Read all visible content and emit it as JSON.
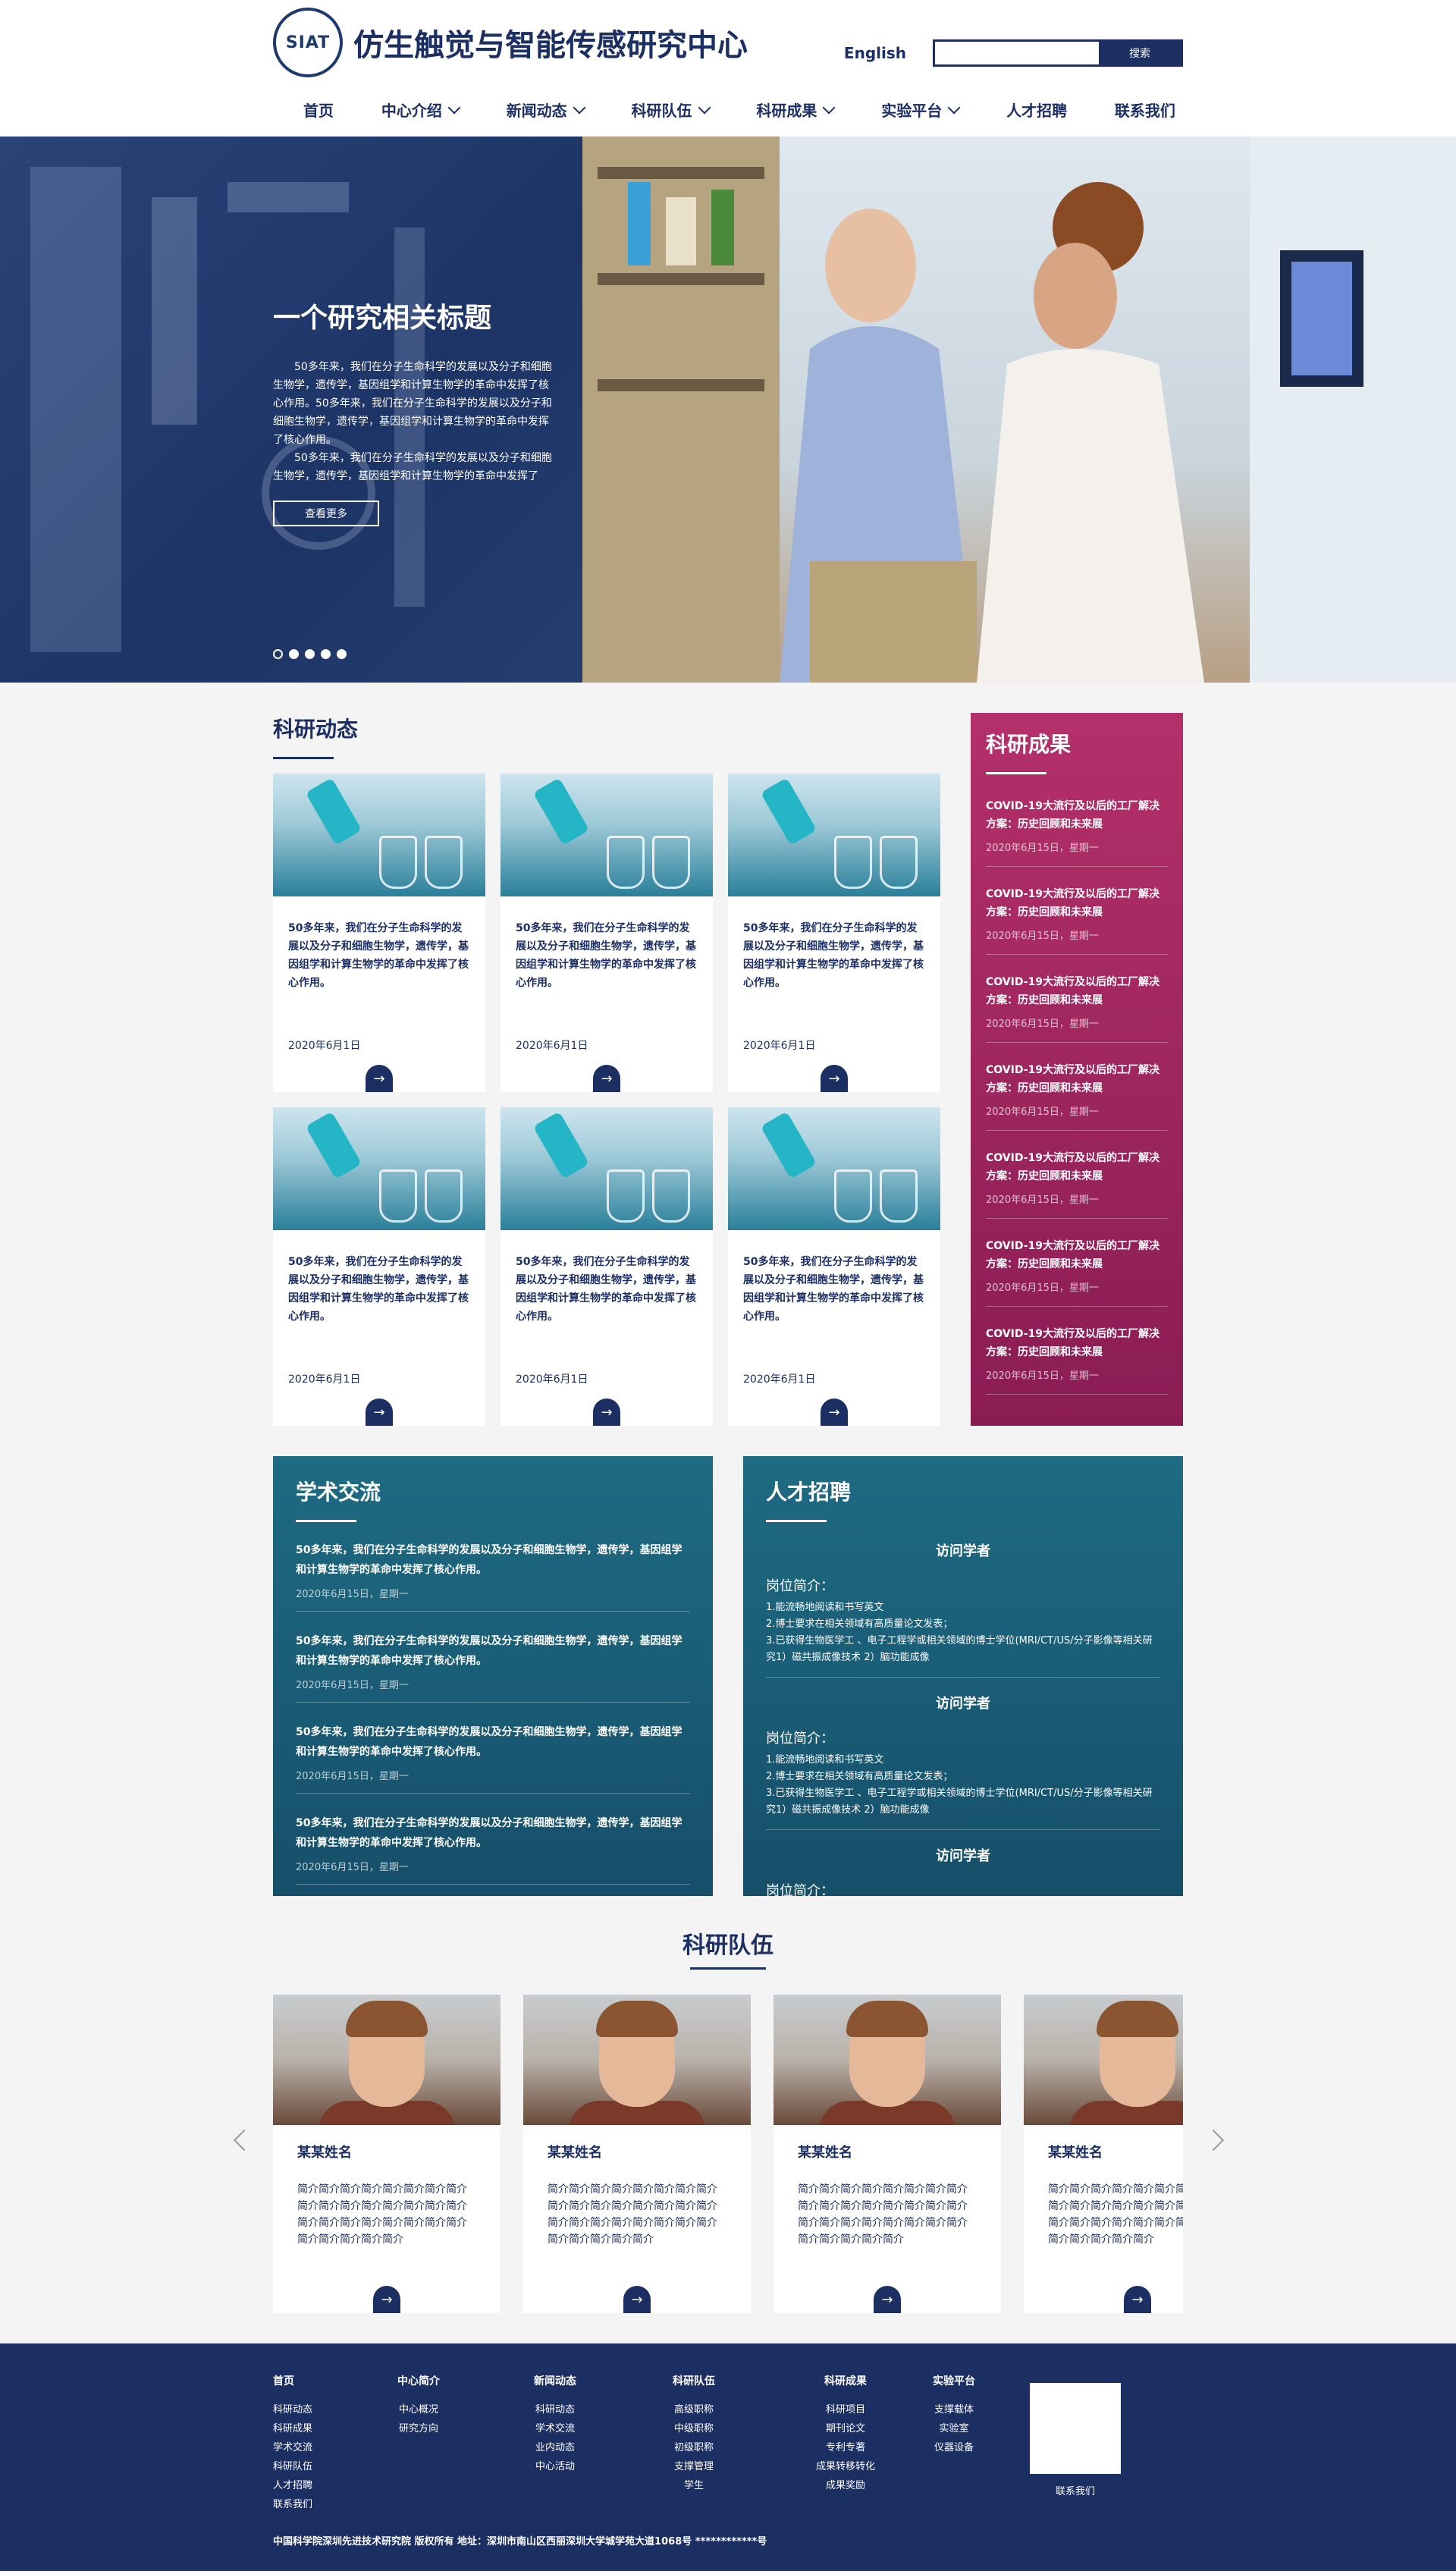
{
  "header": {
    "logo_text": "SIAT",
    "title": "仿生触觉与智能传感研究中心",
    "lang": "English",
    "search_placeholder": "",
    "search_button": "搜索"
  },
  "nav": [
    {
      "label": "首页",
      "has_menu": false
    },
    {
      "label": "中心介绍",
      "has_menu": true
    },
    {
      "label": "新闻动态",
      "has_menu": true
    },
    {
      "label": "科研队伍",
      "has_menu": true
    },
    {
      "label": "科研成果",
      "has_menu": true
    },
    {
      "label": "实验平台",
      "has_menu": true
    },
    {
      "label": "人才招聘",
      "has_menu": false
    },
    {
      "label": "联系我们",
      "has_menu": false
    }
  ],
  "hero": {
    "title": "一个研究相关标题",
    "paragraphs": [
      "50多年来，我们在分子生命科学的发展以及分子和细胞生物学，遗传学，基因组学和计算生物学的革命中发挥了核心作用。50多年来，我们在分子生命科学的发展以及分子和细胞生物学，遗传学，基因组学和计算生物学的革命中发挥了核心作用。",
      "50多年来，我们在分子生命科学的发展以及分子和细胞生物学，遗传学，基因组学和计算生物学的革命中发挥了"
    ],
    "button": "查看更多",
    "dots": 5
  },
  "news": {
    "title": "科研动态",
    "items": [
      {
        "text": "50多年来，我们在分子生命科学的发展以及分子和细胞生物学，遗传学，基因组学和计算生物学的革命中发挥了核心作用。",
        "date": "2020年6月1日"
      },
      {
        "text": "50多年来，我们在分子生命科学的发展以及分子和细胞生物学，遗传学，基因组学和计算生物学的革命中发挥了核心作用。",
        "date": "2020年6月1日"
      },
      {
        "text": "50多年来，我们在分子生命科学的发展以及分子和细胞生物学，遗传学，基因组学和计算生物学的革命中发挥了核心作用。",
        "date": "2020年6月1日"
      },
      {
        "text": "50多年来，我们在分子生命科学的发展以及分子和细胞生物学，遗传学，基因组学和计算生物学的革命中发挥了核心作用。",
        "date": "2020年6月1日"
      },
      {
        "text": "50多年来，我们在分子生命科学的发展以及分子和细胞生物学，遗传学，基因组学和计算生物学的革命中发挥了核心作用。",
        "date": "2020年6月1日"
      },
      {
        "text": "50多年来，我们在分子生命科学的发展以及分子和细胞生物学，遗传学，基因组学和计算生物学的革命中发挥了核心作用。",
        "date": "2020年6月1日"
      }
    ]
  },
  "results": {
    "title": "科研成果",
    "items": [
      {
        "title": "COVID-19大流行及以后的工厂解决方案：历史回顾和未来展",
        "date": "2020年6月15日，星期一"
      },
      {
        "title": "COVID-19大流行及以后的工厂解决方案：历史回顾和未来展",
        "date": "2020年6月15日，星期一"
      },
      {
        "title": "COVID-19大流行及以后的工厂解决方案：历史回顾和未来展",
        "date": "2020年6月15日，星期一"
      },
      {
        "title": "COVID-19大流行及以后的工厂解决方案：历史回顾和未来展",
        "date": "2020年6月15日，星期一"
      },
      {
        "title": "COVID-19大流行及以后的工厂解决方案：历史回顾和未来展",
        "date": "2020年6月15日，星期一"
      },
      {
        "title": "COVID-19大流行及以后的工厂解决方案：历史回顾和未来展",
        "date": "2020年6月15日，星期一"
      },
      {
        "title": "COVID-19大流行及以后的工厂解决方案：历史回顾和未来展",
        "date": "2020年6月15日，星期一"
      }
    ]
  },
  "academic": {
    "title": "学术交流",
    "items": [
      {
        "title": "50多年来，我们在分子生命科学的发展以及分子和细胞生物学，遗传学，基因组学和计算生物学的革命中发挥了核心作用。",
        "date": "2020年6月15日，星期一"
      },
      {
        "title": "50多年来，我们在分子生命科学的发展以及分子和细胞生物学，遗传学，基因组学和计算生物学的革命中发挥了核心作用。",
        "date": "2020年6月15日，星期一"
      },
      {
        "title": "50多年来，我们在分子生命科学的发展以及分子和细胞生物学，遗传学，基因组学和计算生物学的革命中发挥了核心作用。",
        "date": "2020年6月15日，星期一"
      },
      {
        "title": "50多年来，我们在分子生命科学的发展以及分子和细胞生物学，遗传学，基因组学和计算生物学的革命中发挥了核心作用。",
        "date": "2020年6月15日，星期一"
      }
    ]
  },
  "talent": {
    "title": "人才招聘",
    "jobs": [
      {
        "heading": "访问学者",
        "label": "岗位简介：",
        "reqs": [
          "1.能流畅地阅读和书写英文",
          "2.博士要求在相关领域有高质量论文发表；",
          "3.已获得生物医学工 、电子工程学或相关领域的博士学位(MRI/CT/US/分子影像等相关研究1）磁共振成像技术 2）脑功能成像"
        ]
      },
      {
        "heading": "访问学者",
        "label": "岗位简介：",
        "reqs": [
          "1.能流畅地阅读和书写英文",
          "2.博士要求在相关领域有高质量论文发表；",
          "3.已获得生物医学工 、电子工程学或相关领域的博士学位(MRI/CT/US/分子影像等相关研究1）磁共振成像技术 2）脑功能成像"
        ]
      },
      {
        "heading": "访问学者",
        "label": "岗位简介：",
        "reqs": []
      }
    ]
  },
  "team": {
    "title": "科研队伍",
    "members": [
      {
        "name": "某某姓名",
        "intro": "简介简介简介简介简介简介简介简介简介简介简介简介简介简介简介简介简介简介简介简介简介简介简介简介简介简介简介简介简介"
      },
      {
        "name": "某某姓名",
        "intro": "简介简介简介简介简介简介简介简介简介简介简介简介简介简介简介简介简介简介简介简介简介简介简介简介简介简介简介简介简介"
      },
      {
        "name": "某某姓名",
        "intro": "简介简介简介简介简介简介简介简介简介简介简介简介简介简介简介简介简介简介简介简介简介简介简介简介简介简介简介简介简介"
      },
      {
        "name": "某某姓名",
        "intro": "简介简介简介简介简介简介简介简介简介简介简介简介简介简介简介简介简介简介简介简介简介简介简介简介简介简介简介简介简介"
      }
    ]
  },
  "footer": {
    "columns": [
      {
        "heading": "首页",
        "links": [
          "科研动态",
          "科研成果",
          "学术交流",
          "科研队伍",
          "人才招聘",
          "联系我们"
        ]
      },
      {
        "heading": "中心简介",
        "links": [
          "中心概况",
          "研究方向"
        ]
      },
      {
        "heading": "新闻动态",
        "links": [
          "科研动态",
          "学术交流",
          "业内动态",
          "中心活动"
        ]
      },
      {
        "heading": "科研队伍",
        "links": [
          "高级职称",
          "中级职称",
          "初级职称",
          "支撑管理",
          "学生"
        ]
      },
      {
        "heading": "科研成果",
        "links": [
          "科研项目",
          "期刊论文",
          "专利专著",
          "成果转移转化",
          "成果奖励"
        ]
      },
      {
        "heading": "实验平台",
        "links": [
          "支撑载体",
          "实验室",
          "仪器设备"
        ]
      }
    ],
    "qr_label": "联系我们",
    "copyright": "中国科学院深圳先进技术研究院    版权所有    地址：深圳市南山区西丽深圳大学城学苑大道1068号  ************号"
  }
}
